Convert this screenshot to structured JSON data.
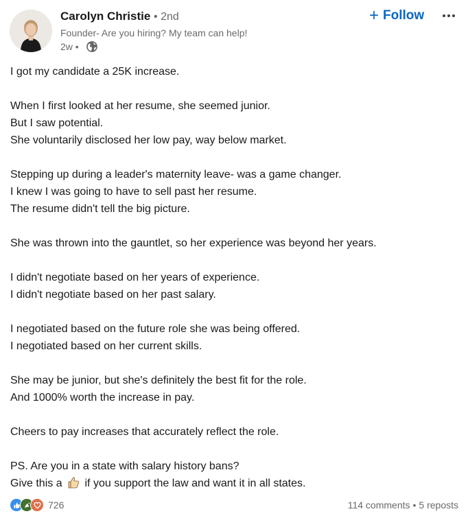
{
  "author": {
    "name": "Carolyn Christie",
    "degree": "• 2nd",
    "headline": "Founder- Are you hiring? My team can help!",
    "time": "2w •"
  },
  "actions": {
    "follow_label": "Follow",
    "more_icon": "ellipsis-icon"
  },
  "post": {
    "lines": [
      "I got my candidate a 25K increase.",
      "",
      "When I first looked at her resume, she seemed junior.",
      "But I saw potential.",
      "She voluntarily disclosed her low pay, way below market.",
      "",
      "Stepping up during a leader's maternity leave- was a game changer.",
      "I knew I was going to have to sell past her resume.",
      "The resume didn't tell the big picture.",
      "",
      "She was thrown into the gauntlet, so her experience was beyond her years.",
      "",
      "I didn't negotiate based on her years of experience.",
      "I didn't negotiate based on her past salary.",
      "",
      "I negotiated based on the future role she was being offered.",
      "I negotiated based on her current skills.",
      "",
      "She may be junior, but she's definitely the best fit for the role.",
      "And 1000% worth the increase in pay.",
      "",
      "Cheers to pay increases that accurately reflect the role.",
      "",
      "PS. Are you in a state with salary history bans?"
    ],
    "last_line_before": "Give this a",
    "last_line_after": "if you support the law and want it in all states."
  },
  "social": {
    "reaction_count": "726",
    "comments": "114 comments",
    "separator": "•",
    "reposts": "5 reposts"
  },
  "colors": {
    "accent": "#0a66c2",
    "like": "#378fe9",
    "celebrate": "#44712e",
    "love": "#df704d"
  }
}
